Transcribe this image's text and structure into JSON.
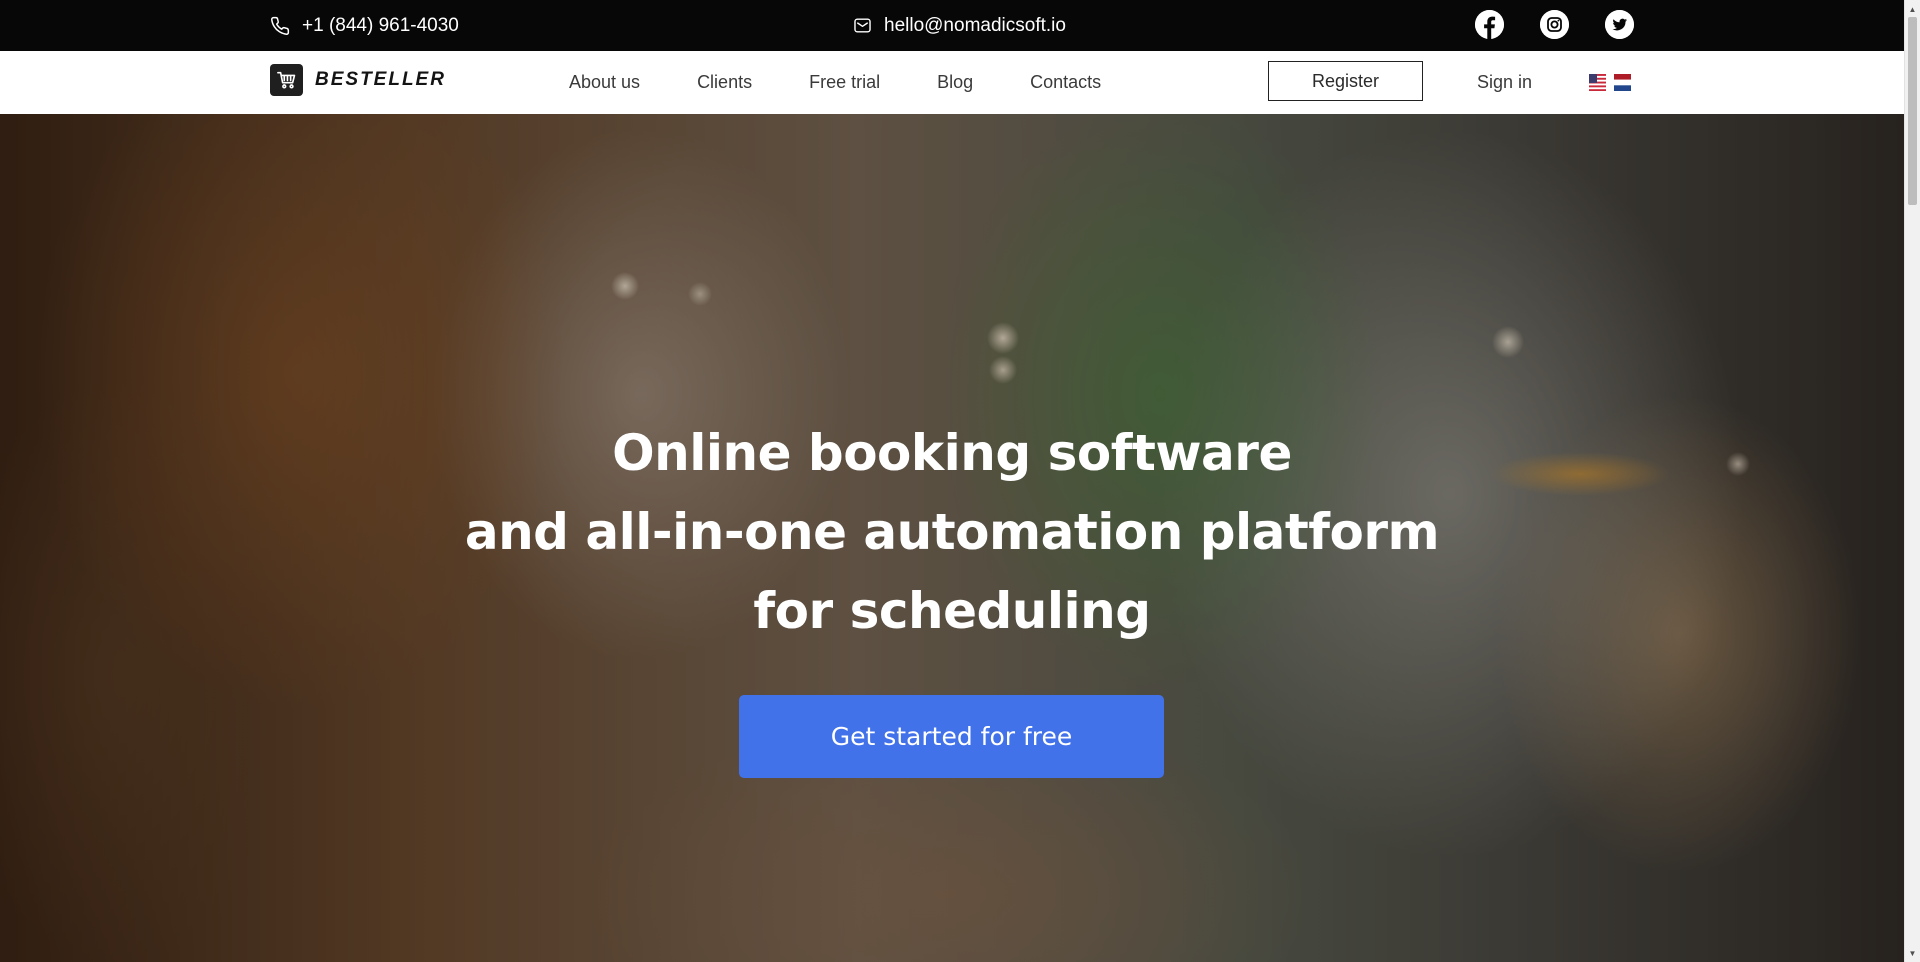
{
  "topbar": {
    "phone": "+1 (844) 961-4030",
    "email": "hello@nomadicsoft.io",
    "socials": [
      "facebook-icon",
      "instagram-icon",
      "twitter-icon"
    ]
  },
  "brand": {
    "name": "BESTELLER",
    "logo_icon": "cart-icon"
  },
  "nav": {
    "links": [
      "About us",
      "Clients",
      "Free trial",
      "Blog",
      "Contacts"
    ],
    "register_label": "Register",
    "signin_label": "Sign in",
    "languages": [
      "en-us-flag",
      "nl-flag"
    ]
  },
  "hero": {
    "title_lines": [
      "Online booking software",
      "and all-in-one automation platform",
      "for scheduling"
    ],
    "cta_label": "Get started for free"
  },
  "colors": {
    "topbar_bg": "#070707",
    "cta_bg": "#4272ea",
    "nav_bg": "#ffffff"
  }
}
